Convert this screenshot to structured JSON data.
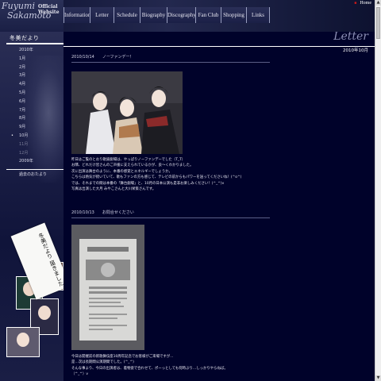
{
  "header": {
    "logo_script": "Fuyumi\n  Sakamoto",
    "logo_official": "Official\nWebsite",
    "home_link": "Home"
  },
  "nav": {
    "items": [
      {
        "label": "Information"
      },
      {
        "label": "Letter"
      },
      {
        "label": "Schedule"
      },
      {
        "label": "Biography"
      },
      {
        "label": "Discography"
      },
      {
        "label": "Fan Club"
      },
      {
        "label": "Shopping"
      },
      {
        "label": "Links"
      }
    ]
  },
  "sidebar": {
    "title": "冬美だより",
    "months": [
      {
        "label": "2010年",
        "state": "normal"
      },
      {
        "label": "1月",
        "state": "normal"
      },
      {
        "label": "2月",
        "state": "normal"
      },
      {
        "label": "3月",
        "state": "normal"
      },
      {
        "label": "4月",
        "state": "normal"
      },
      {
        "label": "5月",
        "state": "normal"
      },
      {
        "label": "6月",
        "state": "normal"
      },
      {
        "label": "7月",
        "state": "normal"
      },
      {
        "label": "8月",
        "state": "normal"
      },
      {
        "label": "9月",
        "state": "normal"
      },
      {
        "label": "10月",
        "state": "active"
      },
      {
        "label": "11月",
        "state": "dim"
      },
      {
        "label": "12月",
        "state": "dim"
      },
      {
        "label": "2009年",
        "state": "normal"
      }
    ],
    "message_label": "過去のおたより",
    "note_text": "冬美だより\n届きました"
  },
  "main": {
    "title": "Letter",
    "month": "2010年10月",
    "entries": [
      {
        "date": "2010/10/14",
        "title": "ノーファンデー！",
        "lines": [
          "昨日はご覧のとおり歌謡劇場は、やっぱりノーファンデーでした（T_T）",
          "お隣、どれだけ皆さんのご声援に支えられているかが、良～くわかりました。",
          "次に出演は舞台のように、本番の感覚とエネルギーでしょうか。",
          "こちらは熱気が続いていて、歌もファンの方も感じて、テレビの前からもパワーを送ってくださいね！(^o^)",
          "では、それまでの間は本番の「舞台劇場」と、10月の日本公演も是非お楽しみください！(^_^)v",
          "写真は出演した大月 みやこさんと大川栄策さんです。"
        ]
      },
      {
        "date": "2010/10/13",
        "title": "お問合せください",
        "lines": [
          "今日は開催前の新歌舞伎座10周年記念でお客様がご来場ですが…",
          "是…次は長期間公演期間でした。(^_^)",
          "そんな事より、今日の出演者は、着物姿で合わせて、ポーっとしても何時ぶり…しっかりやらねば。",
          "（^_^）v"
        ]
      }
    ]
  },
  "colors": {
    "background": "#00022a",
    "header": "#23284e",
    "accent_red": "#d01a1a",
    "title_gray": "#8c8fb4"
  },
  "scrollbar": {
    "up_icon": "▲",
    "down_icon": "▼"
  }
}
